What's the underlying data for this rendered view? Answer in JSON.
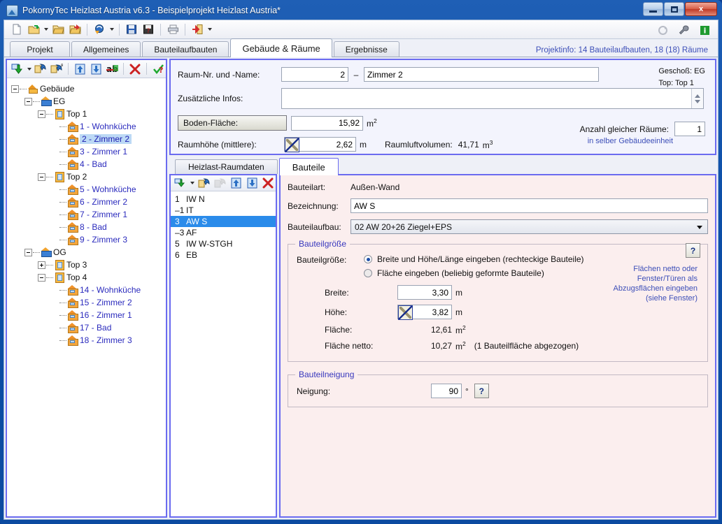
{
  "window": {
    "title": "PokornyTec  Heizlast Austria v6.3  -  Beispielprojekt Heizlast Austria*",
    "minimize_label": "Minimize",
    "maximize_label": "Maximize",
    "close_label": "x"
  },
  "toolbar": {
    "items": [
      {
        "name": "new-document-icon",
        "title": "Neu"
      },
      {
        "name": "open-project-icon",
        "title": "Öffnen"
      },
      {
        "name": "open-folder-icon",
        "title": "Projekt öffnen"
      },
      {
        "name": "open-recent-icon",
        "title": "Zuletzt verwendet"
      },
      {
        "name": "refresh-icon",
        "title": "Aktualisieren"
      },
      {
        "name": "save-icon",
        "title": "Speichern"
      },
      {
        "name": "save-as-icon",
        "title": "Speichern unter"
      },
      {
        "name": "print-icon",
        "title": "Drucken"
      },
      {
        "name": "export-icon",
        "title": "Exportieren"
      }
    ],
    "right_items": [
      {
        "name": "recycle-icon",
        "title": "Zurücksetzen"
      },
      {
        "name": "wrench-icon",
        "title": "Einstellungen"
      },
      {
        "name": "info-icon",
        "title": "Info",
        "label": "i"
      }
    ]
  },
  "tabs": [
    {
      "label": "Projekt",
      "active": false
    },
    {
      "label": "Allgemeines",
      "active": false
    },
    {
      "label": "Bauteilaufbauten",
      "active": false
    },
    {
      "label": "Gebäude & Räume",
      "active": true
    },
    {
      "label": "Ergebnisse",
      "active": false
    }
  ],
  "project_info": "Projektinfo: 14 Bauteilaufbauten,  18 (18) Räume",
  "tree": {
    "toolbar": [
      {
        "name": "add-room-icon",
        "title": "Neu hinzufügen"
      },
      {
        "name": "copy-paste-icon",
        "title": "Einfügen"
      },
      {
        "name": "copy-replace-icon",
        "title": "Ersetzen"
      },
      {
        "name": "move-up-icon",
        "title": "Nach oben"
      },
      {
        "name": "move-down-icon",
        "title": "Nach unten"
      },
      {
        "name": "rename-icon",
        "title": "Umbenennen"
      },
      {
        "name": "delete-icon",
        "title": "Löschen"
      },
      {
        "name": "check-icon",
        "title": "Prüfen"
      }
    ],
    "nodes": [
      {
        "label": "Gebäude",
        "depth": 0,
        "icon": "building-root-icon",
        "expander": "minus",
        "color": "black"
      },
      {
        "label": "EG",
        "depth": 1,
        "icon": "floor-icon",
        "expander": "minus",
        "color": "black"
      },
      {
        "label": "Top 1",
        "depth": 2,
        "icon": "unit-icon",
        "expander": "minus",
        "color": "black"
      },
      {
        "label": "1 - Wohnküche",
        "depth": 3,
        "icon": "room-icon",
        "expander": "none",
        "color": "blue"
      },
      {
        "label": "2 - Zimmer 2",
        "depth": 3,
        "icon": "room-icon",
        "expander": "none",
        "color": "blue",
        "selected": true
      },
      {
        "label": "3 - Zimmer 1",
        "depth": 3,
        "icon": "room-icon",
        "expander": "none",
        "color": "blue"
      },
      {
        "label": "4 - Bad",
        "depth": 3,
        "icon": "room-icon",
        "expander": "none",
        "color": "blue"
      },
      {
        "label": "Top 2",
        "depth": 2,
        "icon": "unit-icon",
        "expander": "minus",
        "color": "black"
      },
      {
        "label": "5 - Wohnküche",
        "depth": 3,
        "icon": "room-icon",
        "expander": "none",
        "color": "blue"
      },
      {
        "label": "6 - Zimmer 2",
        "depth": 3,
        "icon": "room-icon",
        "expander": "none",
        "color": "blue"
      },
      {
        "label": "7 - Zimmer 1",
        "depth": 3,
        "icon": "room-icon",
        "expander": "none",
        "color": "blue"
      },
      {
        "label": "8 - Bad",
        "depth": 3,
        "icon": "room-icon",
        "expander": "none",
        "color": "blue"
      },
      {
        "label": "9 - Zimmer 3",
        "depth": 3,
        "icon": "room-icon",
        "expander": "none",
        "color": "blue"
      },
      {
        "label": "OG",
        "depth": 1,
        "icon": "floor-icon",
        "expander": "minus",
        "color": "black"
      },
      {
        "label": "Top 3",
        "depth": 2,
        "icon": "unit-icon",
        "expander": "plus",
        "color": "black"
      },
      {
        "label": "Top 4",
        "depth": 2,
        "icon": "unit-icon",
        "expander": "minus",
        "color": "black"
      },
      {
        "label": "14 - Wohnküche",
        "depth": 3,
        "icon": "room-icon",
        "expander": "none",
        "color": "blue"
      },
      {
        "label": "15 - Zimmer 2",
        "depth": 3,
        "icon": "room-icon",
        "expander": "none",
        "color": "blue"
      },
      {
        "label": "16 - Zimmer 1",
        "depth": 3,
        "icon": "room-icon",
        "expander": "none",
        "color": "blue"
      },
      {
        "label": "17 - Bad",
        "depth": 3,
        "icon": "room-icon",
        "expander": "none",
        "color": "blue"
      },
      {
        "label": "18 - Zimmer 3",
        "depth": 3,
        "icon": "room-icon",
        "expander": "none",
        "color": "blue"
      }
    ]
  },
  "room_form": {
    "room_label": "Raum-Nr. und -Name:",
    "room_number": "2",
    "room_separator": "–",
    "room_name": "Zimmer 2",
    "extra_label": "Zusätzliche Infos:",
    "extra_value": "",
    "floor_area_button": "Boden-Fläche:",
    "floor_area_value": "15,92",
    "floor_area_unit": "m",
    "floor_area_exp": "2",
    "height_label": "Raumhöhe (mittlere):",
    "height_value": "2,62",
    "height_unit": "m",
    "volume_label": "Raumluftvolumen:",
    "volume_value": "41,71",
    "volume_unit": "m",
    "volume_exp": "3",
    "count_label": "Anzahl gleicher Räume:",
    "count_value": "1",
    "count_sub": "in selber Gebäudeeinheit",
    "geschoss": "Geschoß: EG",
    "top": "Top: Top 1"
  },
  "sub_tabs": [
    {
      "label": "Heizlast-Raumdaten",
      "active": false
    },
    {
      "label": "Bauteile",
      "active": true
    }
  ],
  "component_list": {
    "toolbar": [
      {
        "name": "add-component-icon",
        "title": "Neues Bauteil"
      },
      {
        "name": "paste-component-icon",
        "title": "Einfügen"
      },
      {
        "name": "copy-component-icon",
        "title": "Kopieren",
        "disabled": true
      },
      {
        "name": "move-up-icon",
        "title": "Nach oben"
      },
      {
        "name": "move-down-icon",
        "title": "Nach unten"
      },
      {
        "name": "delete-component-icon",
        "title": "Löschen"
      }
    ],
    "items": [
      {
        "num": "1",
        "label": "IW N",
        "selected": false
      },
      {
        "num": "–1",
        "label": "IT",
        "selected": false
      },
      {
        "num": "3",
        "label": "AW S",
        "selected": true
      },
      {
        "num": "–3",
        "label": "AF",
        "selected": false
      },
      {
        "num": "5",
        "label": "IW W-STGH",
        "selected": false
      },
      {
        "num": "6",
        "label": "EB",
        "selected": false
      }
    ]
  },
  "detail": {
    "type_label": "Bauteilart:",
    "type_value": "Außen-Wand",
    "name_label": "Bezeichnung:",
    "name_value": "AW S",
    "assembly_label": "Bauteilaufbau:",
    "assembly_value": "02  AW 20+26 Ziegel+EPS",
    "size_group_legend": "Bauteilgröße",
    "size_mode_label": "Bauteilgröße:",
    "size_option_1": "Breite und Höhe/Länge eingeben (rechteckige Bauteile)",
    "size_option_2": "Fläche eingeben (beliebig geformte Bauteile)",
    "size_selected": 1,
    "width_label": "Breite:",
    "width_value": "3,30",
    "width_unit": "m",
    "height_label": "Höhe:",
    "height_value": "3,82",
    "height_unit": "m",
    "area_label": "Fläche:",
    "area_value": "12,61",
    "area_unit": "m",
    "area_exp": "2",
    "area_net_label": "Fläche netto:",
    "area_net_value": "10,27",
    "area_net_unit": "m",
    "area_net_exp": "2",
    "area_net_note": "(1 Bauteilfläche abgezogen)",
    "help_label": "?",
    "note_line_1": "Flächen netto oder",
    "note_line_2": "Fenster/Türen als",
    "note_line_3": "Abzugsflächen eingeben",
    "note_line_4": "(siehe Fenster)",
    "tilt_group_legend": "Bauteilneigung",
    "tilt_label": "Neigung:",
    "tilt_value": "90",
    "tilt_unit": "°",
    "tilt_help": "?"
  },
  "colors": {
    "accent_border": "#6b6bf0",
    "link": "#3d4fb8",
    "selection": "#2a8bea",
    "tree_selection": "#bcd9f5",
    "detail_bg": "#fbeeee",
    "form_bg": "#f3f4fd",
    "titlebar": "#0c4fa8"
  }
}
